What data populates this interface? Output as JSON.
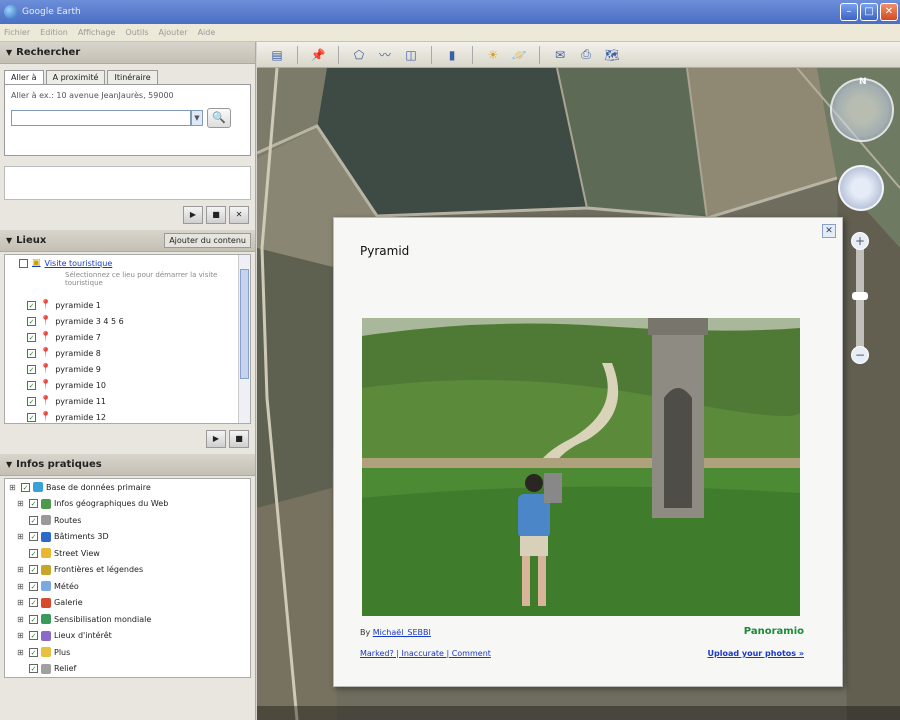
{
  "window": {
    "title": "Google Earth"
  },
  "menu": [
    "Fichier",
    "Edition",
    "Affichage",
    "Outils",
    "Ajouter",
    "Aide"
  ],
  "search": {
    "header": "Rechercher",
    "tabs": [
      "Aller à",
      "A proximité",
      "Itinéraire"
    ],
    "hint": "Aller à ex.: 10 avenue JeanJaurès, 59000",
    "value": ""
  },
  "controls": {
    "play": "▶",
    "stop": "■",
    "close": "✕"
  },
  "places": {
    "header": "Lieux",
    "add_content": "Ajouter du contenu",
    "items": [
      {
        "label": "Visite touristique",
        "link": true
      },
      {
        "label": "pyramide 1"
      },
      {
        "label": "pyramide 3 4 5 6"
      },
      {
        "label": "pyramide 7"
      },
      {
        "label": "pyramide 8"
      },
      {
        "label": "pyramide 9"
      },
      {
        "label": "pyramide 10"
      },
      {
        "label": "pyramide 11"
      },
      {
        "label": "pyramide 12"
      }
    ],
    "tour_desc": "Sélectionnez ce lieu pour démarrer la visite touristique"
  },
  "layers": {
    "header": "Infos pratiques",
    "items": [
      {
        "label": "Base de données primaire",
        "color": "#3aa0d8"
      },
      {
        "label": "Infos géographiques du Web",
        "color": "#4a9a4a"
      },
      {
        "label": "Routes",
        "color": "#999999"
      },
      {
        "label": "Bâtiments 3D",
        "color": "#2a6ac8"
      },
      {
        "label": "Street View",
        "color": "#e8b830"
      },
      {
        "label": "Frontières et légendes",
        "color": "#c8a428"
      },
      {
        "label": "Météo",
        "color": "#7aa8e0"
      },
      {
        "label": "Galerie",
        "color": "#d84a2a"
      },
      {
        "label": "Sensibilisation mondiale",
        "color": "#3a9a5a"
      },
      {
        "label": "Lieux d'intérêt",
        "color": "#8a6ac8"
      },
      {
        "label": "Plus",
        "color": "#e8c040"
      },
      {
        "label": "Relief",
        "color": "#a0a0a0"
      }
    ]
  },
  "popup": {
    "title": "Pyramid",
    "by": "By",
    "author": "Michaël_SEBBI",
    "brand": "Panoramio",
    "links": "Marked? | Inaccurate | Comment",
    "more": "Upload your photos »",
    "close": "✕"
  },
  "toolbar_icons": [
    "sidebar-icon",
    "placemark-icon",
    "polygon-icon",
    "path-icon",
    "overlay-icon",
    "tour-icon",
    "sun-icon",
    "sky-icon",
    "email-icon",
    "print-icon",
    "maps-icon"
  ],
  "nav": {
    "north": "N",
    "zoom_in": "+",
    "zoom_out": "−"
  }
}
